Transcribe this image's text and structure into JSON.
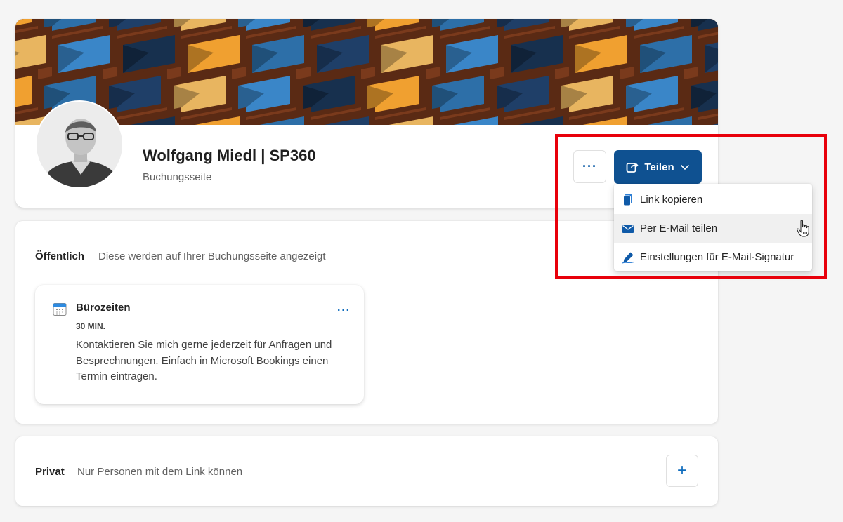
{
  "profile": {
    "name": "Wolfgang Miedl | SP360",
    "subtitle": "Buchungsseite",
    "more_label": "···",
    "share_label": "Teilen"
  },
  "share_menu": {
    "items": [
      {
        "label": "Link kopieren",
        "icon": "copy-icon"
      },
      {
        "label": "Per E-Mail teilen",
        "icon": "mail-icon"
      },
      {
        "label": "Einstellungen für E-Mail-Signatur",
        "icon": "signature-icon"
      }
    ]
  },
  "public_section": {
    "title": "Öffentlich",
    "description": "Diese werden auf Ihrer Buchungsseite angezeigt",
    "service": {
      "title": "Bürozeiten",
      "duration": "30 MIN.",
      "description": "Kontaktieren Sie mich gerne jederzeit für Anfragen und Besprechnungen. Einfach in Microsoft Bookings einen Termin eintragen.",
      "more_label": "···"
    }
  },
  "private_section": {
    "title": "Privat",
    "description": "Nur Personen mit dem Link können",
    "add_label": "+"
  },
  "colors": {
    "primary": "#0f5191",
    "accent": "#0f6cbd",
    "highlight": "#e8000b"
  }
}
